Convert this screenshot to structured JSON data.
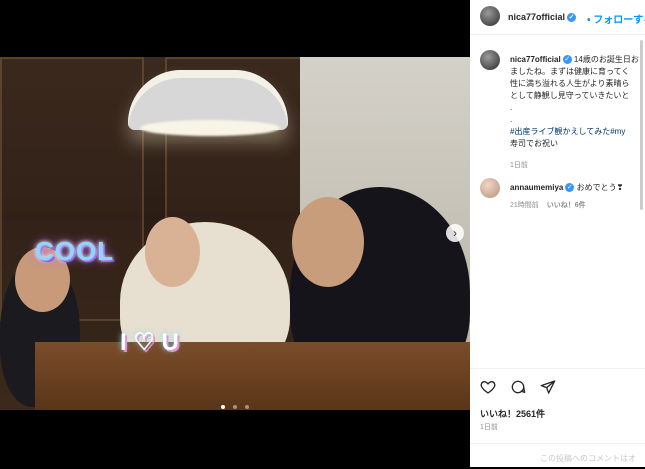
{
  "post": {
    "username": "nica77official",
    "follow_label": "フォローする",
    "separator": "•"
  },
  "caption": {
    "username": "nica77official",
    "text_lines": [
      "14歳のお誕生日お",
      "ましたね。まずは健康に育ってく",
      "性に満ち溢れる人生がより素晴ら",
      "として静観し見守っていきたいと",
      ".",
      "."
    ],
    "tags_line1": "#出産ライブ観かえしてみた#my",
    "tags_line2": "寿司でお祝い",
    "time": "1日前"
  },
  "comment": {
    "username": "annaumemiya",
    "text": "おめでとう❣",
    "time": "21時間前",
    "likes": "いいね！6件"
  },
  "photo": {
    "sticker_cool": "COOL",
    "sticker_iu": "I ♡ U"
  },
  "actions": {
    "likes": "いいね！2561件",
    "date": "1日前",
    "add_comment_placeholder": "この投稿へのコメントはオ"
  }
}
